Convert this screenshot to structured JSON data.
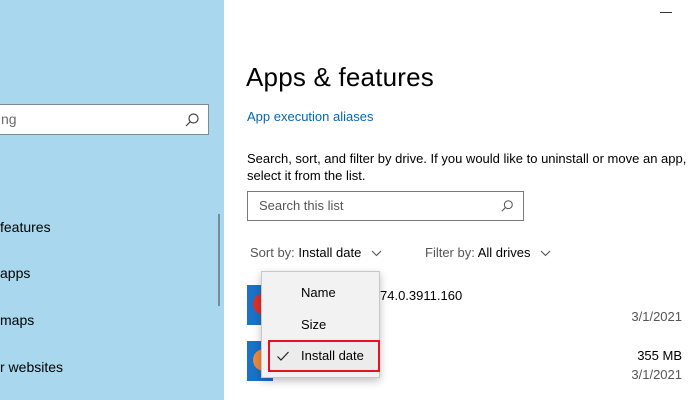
{
  "sidebar": {
    "search_partial": "ng",
    "items": [
      {
        "label": "features"
      },
      {
        "label": "apps"
      },
      {
        "label": "maps"
      },
      {
        "label": "r websites"
      }
    ]
  },
  "main": {
    "title": "Apps & features",
    "aliases_link": "App execution aliases",
    "description": "Search, sort, and filter by drive. If you would like to uninstall or move an app, select it from the list.",
    "search_placeholder": "Search this list",
    "sort": {
      "prefix": "Sort by:",
      "value": "Install date"
    },
    "filter": {
      "prefix": "Filter by:",
      "value": "All drives"
    },
    "apps": [
      {
        "version_partial": "74.0.3911.160",
        "size": "",
        "date": "3/1/2021"
      },
      {
        "version_partial": "",
        "size": "355 MB",
        "date": "3/1/2021"
      }
    ]
  },
  "sort_menu": {
    "options": [
      {
        "label": "Name",
        "selected": false
      },
      {
        "label": "Size",
        "selected": false
      },
      {
        "label": "Install date",
        "selected": true
      }
    ]
  },
  "colors": {
    "sidebar_bg": "#a9d8ee",
    "link": "#0067b8",
    "highlight": "#e81123",
    "app_icon": "#1a73c9"
  }
}
